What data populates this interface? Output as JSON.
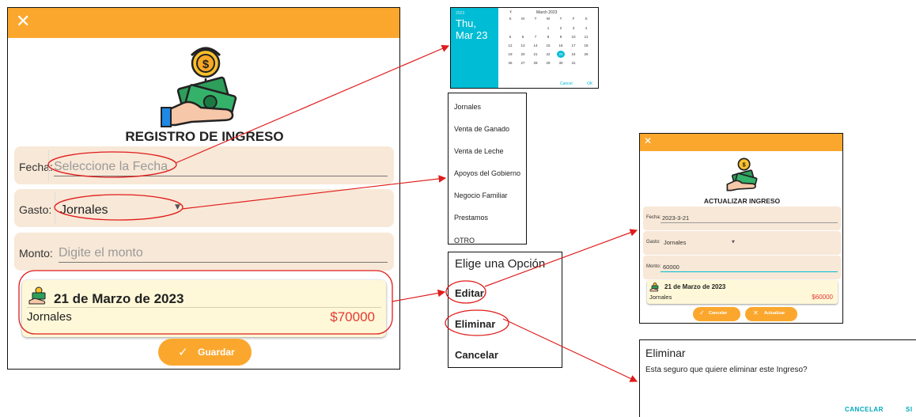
{
  "main": {
    "close_icon": "✕",
    "title": "REGISTRO DE INGRESO",
    "fecha_label": "Fecha:",
    "fecha_placeholder": "Seleccione la Fecha",
    "gasto_label": "Gasto:",
    "gasto_value": "Jornales",
    "monto_label": "Monto:",
    "monto_placeholder": "Digite el monto",
    "record": {
      "date": "21 de Marzo de 2023",
      "concept": "Jornales",
      "amount": "$70000"
    },
    "save_label": "Guardar",
    "accent": "#fba72e"
  },
  "calendar": {
    "year": "2023",
    "selected_day": "Thu,",
    "selected_date": "Mar 23",
    "month_title": "March 2023",
    "prev_icon": "‹",
    "weekdays": [
      "S",
      "M",
      "T",
      "W",
      "T",
      "F",
      "S"
    ],
    "weeks": [
      [
        "",
        "",
        "",
        "1",
        "2",
        "3",
        "4"
      ],
      [
        "5",
        "6",
        "7",
        "8",
        "9",
        "10",
        "11"
      ],
      [
        "12",
        "13",
        "14",
        "15",
        "16",
        "17",
        "18"
      ],
      [
        "19",
        "20",
        "21",
        "22",
        "23",
        "24",
        "25"
      ],
      [
        "26",
        "27",
        "28",
        "29",
        "30",
        "31",
        ""
      ]
    ],
    "selected": "23",
    "cancel_label": "Cancel",
    "ok_label": "OK",
    "accent": "#00bcd4"
  },
  "options": [
    "Jornales",
    "Venta de Ganado",
    "Venta de Leche",
    "Apoyos del Gobierno",
    "Negocio Familiar",
    "Prestamos",
    "OTRO"
  ],
  "actions": {
    "title": "Elige una Opción",
    "edit": "Editar",
    "delete": "Eliminar",
    "cancel": "Cancelar"
  },
  "update": {
    "close_icon": "✕",
    "title": "ACTUALIZAR INGRESO",
    "fecha_label": "Fecha:",
    "fecha_value": "2023-3-21",
    "gasto_label": "Gasto:",
    "gasto_value": "Jornales",
    "monto_label": "Monto:",
    "monto_value": "60000",
    "record": {
      "date": "21 de Marzo de 2023",
      "concept": "Jornales",
      "amount": "$60000"
    },
    "cancel_label": "Cancelar",
    "update_label": "Actualizar"
  },
  "delete_dialog": {
    "title": "Eliminar",
    "message": "Esta seguro que quiere eliminar este Ingreso?",
    "cancel_label": "CANCELAR",
    "confirm_label": "SI"
  }
}
